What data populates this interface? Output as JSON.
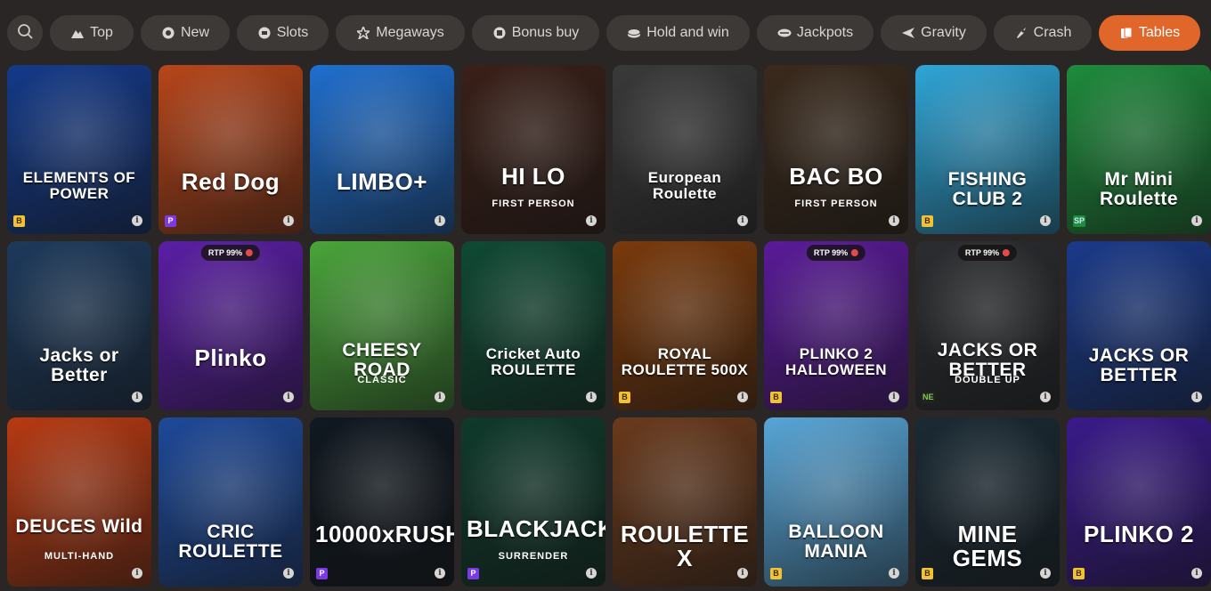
{
  "filters": [
    {
      "label": "Top",
      "icon": "mountain-icon",
      "active": false
    },
    {
      "label": "New",
      "icon": "new-badge-icon",
      "active": false
    },
    {
      "label": "Slots",
      "icon": "slot-icon",
      "active": false
    },
    {
      "label": "Megaways",
      "icon": "star-icon",
      "active": false
    },
    {
      "label": "Bonus buy",
      "icon": "coin-icon",
      "active": false
    },
    {
      "label": "Hold and win",
      "icon": "coins-icon",
      "active": false
    },
    {
      "label": "Jackpots",
      "icon": "jackpot-icon",
      "active": false
    },
    {
      "label": "Gravity",
      "icon": "plane-icon",
      "active": false
    },
    {
      "label": "Crash",
      "icon": "rocket-icon",
      "active": false
    },
    {
      "label": "Tables",
      "icon": "cards-icon",
      "active": true
    }
  ],
  "accent_color": "#e0662a",
  "games": [
    {
      "title": "ELEMENTS OF POWER",
      "provider": "B",
      "bg": "#143a8a",
      "rtp": ""
    },
    {
      "title": "Red Dog",
      "provider": "P",
      "bg": "#b8461a",
      "rtp": ""
    },
    {
      "title": "LIMBO+",
      "provider": "",
      "bg": "#1f6fd0",
      "rtp": ""
    },
    {
      "title": "HI LO",
      "sub": "FIRST PERSON",
      "provider": "",
      "bg": "#3a2018",
      "rtp": ""
    },
    {
      "title": "European Roulette",
      "provider": "",
      "bg": "#3a3a3a",
      "rtp": ""
    },
    {
      "title": "BAC BO",
      "sub": "FIRST PERSON",
      "provider": "",
      "bg": "#3a2a1c",
      "rtp": ""
    },
    {
      "title": "FISHING CLUB 2",
      "provider": "B",
      "bg": "#2fa6d8",
      "rtp": ""
    },
    {
      "title": "Mr Mini Roulette",
      "provider": "SP",
      "bg": "#1e8c3c",
      "rtp": ""
    },
    {
      "title": "Jacks or Better",
      "provider": "",
      "bg": "#1d3a5c",
      "rtp": ""
    },
    {
      "title": "Plinko",
      "provider": "",
      "bg": "#5b1ea6",
      "rtp": "RTP 99%"
    },
    {
      "title": "CHEESY ROAD",
      "sub": "CLASSIC",
      "provider": "",
      "bg": "#4aa53a",
      "rtp": ""
    },
    {
      "title": "Cricket Auto ROULETTE",
      "provider": "",
      "bg": "#0f4a34",
      "rtp": ""
    },
    {
      "title": "ROYAL ROULETTE 500X",
      "provider": "B",
      "bg": "#7a3a0c",
      "rtp": ""
    },
    {
      "title": "PLINKO 2 HALLOWEEN",
      "provider": "B",
      "bg": "#5a1a9a",
      "rtp": "RTP 99%"
    },
    {
      "title": "JACKS OR BETTER",
      "sub": "DOUBLE UP",
      "provider": "NE",
      "bg": "#2b2d30",
      "rtp": "RTP 99%"
    },
    {
      "title": "JACKS OR BETTER",
      "provider": "",
      "bg": "#1a3a8a",
      "rtp": ""
    },
    {
      "title": "DEUCES Wild",
      "sub": "MULTI-HAND",
      "provider": "",
      "bg": "#b83a12",
      "rtp": ""
    },
    {
      "title": "CRIC ROULETTE",
      "provider": "",
      "bg": "#1e4a9a",
      "rtp": ""
    },
    {
      "title": "10000xRUSH",
      "provider": "P",
      "bg": "#101820",
      "rtp": ""
    },
    {
      "title": "BLACKJACK",
      "sub": "SURRENDER",
      "provider": "P",
      "bg": "#0f3a2c",
      "rtp": ""
    },
    {
      "title": "ROULETTE X",
      "provider": "",
      "bg": "#6a3a1c",
      "rtp": ""
    },
    {
      "title": "BALLOON MANIA",
      "provider": "B",
      "bg": "#58a6d8",
      "rtp": ""
    },
    {
      "title": "MINE GEMS",
      "provider": "B",
      "bg": "#1a2a34",
      "rtp": ""
    },
    {
      "title": "PLINKO 2",
      "provider": "B",
      "bg": "#3a1a8a",
      "rtp": ""
    }
  ]
}
